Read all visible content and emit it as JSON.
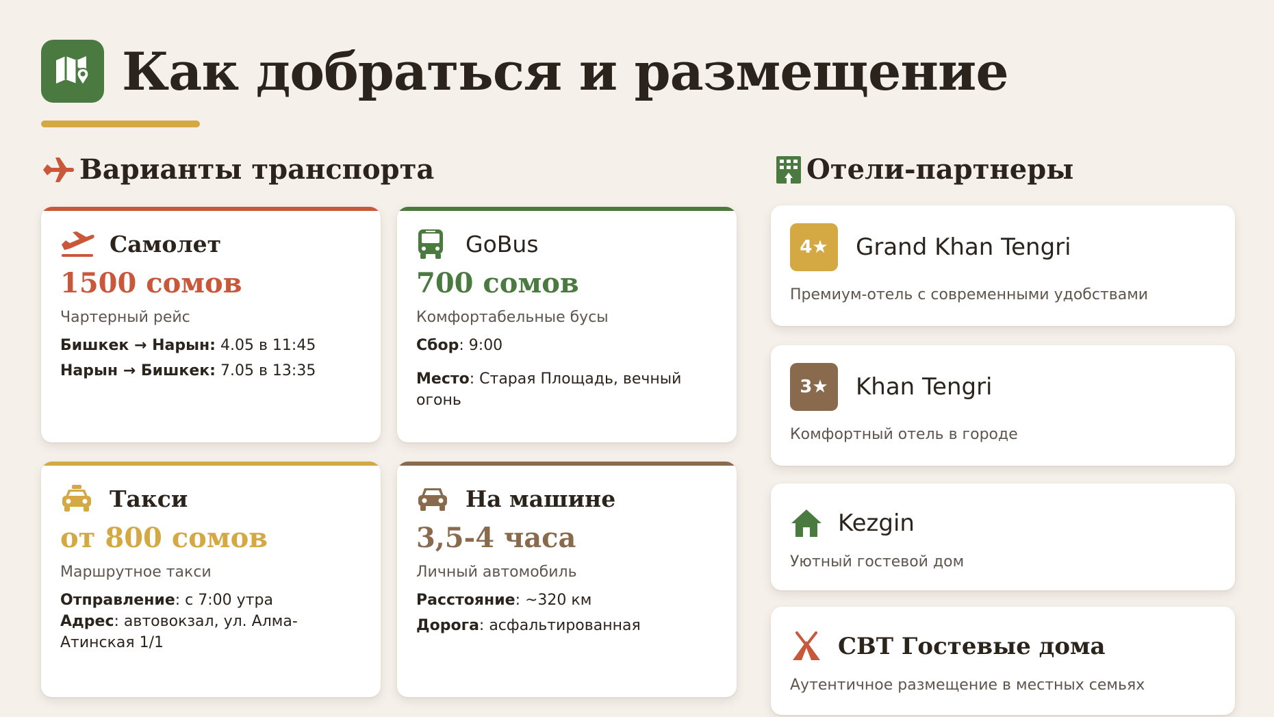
{
  "page": {
    "title": "Как добраться и размещение",
    "accent_colors": {
      "green": "#4a7a3f",
      "gold": "#d4a843",
      "red": "#c9573a",
      "brown": "#8a6a4c"
    }
  },
  "transport": {
    "heading": "Варианты транспорта",
    "icon": "airplane-icon",
    "cards": [
      {
        "icon": "airplane-departure-icon",
        "name": "Самолет",
        "price": "1500 сомов",
        "subtitle": "Чартерный рейс",
        "lines": [
          {
            "label": "Бишкек → Нарын:",
            "value": " 4.05 в 11:45"
          },
          {
            "label": "Нарын → Бишкек:",
            "value": " 7.05 в 13:35"
          }
        ],
        "color": "#c9573a"
      },
      {
        "icon": "bus-icon",
        "name": "GoBus",
        "price": "700 сомов",
        "subtitle": "Комфортабельные бусы",
        "lines": [
          {
            "label": "Сбор",
            "value": ": 9:00"
          },
          {
            "label": "Место",
            "value": ": Старая Площадь, вечный огонь"
          }
        ],
        "color": "#4a7a3f"
      },
      {
        "icon": "taxi-icon",
        "name": "Такси",
        "price": "от 800 сомов",
        "subtitle": "Маршрутное такси",
        "lines": [
          {
            "label": "Отправление",
            "value": ": с 7:00 утра"
          },
          {
            "label": "Адрес",
            "value": ": автовокзал, ул. Алма-Атинская 1/1"
          }
        ],
        "color": "#d4a843"
      },
      {
        "icon": "car-icon",
        "name": "На машине",
        "price": "3,5-4 часа",
        "subtitle": "Личный автомобиль",
        "lines": [
          {
            "label": "Расстояние",
            "value": ": ~320 км"
          },
          {
            "label": "Дорога",
            "value": ": асфальтированная"
          }
        ],
        "color": "#8a6a4c"
      }
    ]
  },
  "hotels": {
    "heading": "Отели-партнеры",
    "icon": "hotel-building-icon",
    "items": [
      {
        "badge": "4★",
        "name": "Grand Khan Tengri",
        "description": "Премиум-отель с современными удобствами",
        "color": "#d4a843"
      },
      {
        "badge": "3★",
        "name": "Khan Tengri",
        "description": "Комфортный отель в городе",
        "color": "#8a6a4c"
      },
      {
        "icon": "house-icon",
        "name": "Kezgin",
        "description": "Уютный гостевой дом",
        "color": "#4a7a3f"
      },
      {
        "icon": "tent-icon",
        "name": "CBT Гостевые дома",
        "description": "Аутентичное размещение в местных семьях",
        "color": "#c9573a"
      }
    ]
  }
}
